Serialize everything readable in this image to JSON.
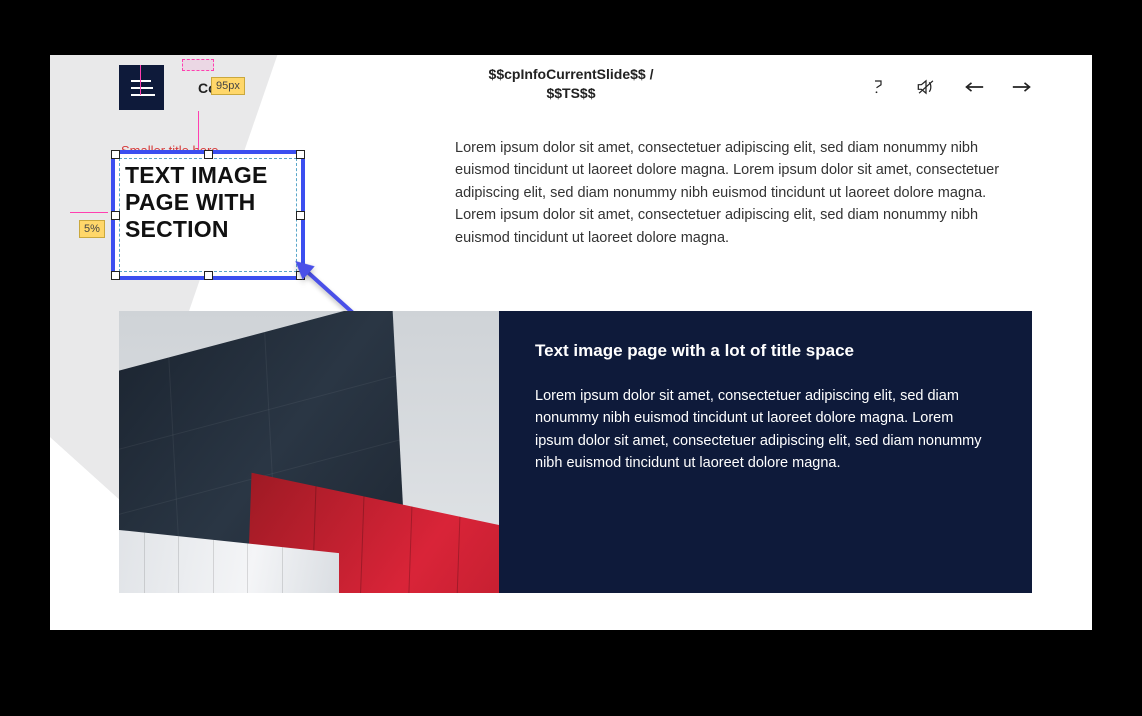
{
  "header": {
    "course_title_visible": "Co        title",
    "badge_95": "95px",
    "slide_info_line1": "$$cpInfoCurrentSlide$$ /",
    "slide_info_line2": "$$TS$$"
  },
  "small_title": "Smaller title here",
  "selected_textbox": "TEXT IMAGE PAGE WITH SECTION",
  "badge_5": "5%",
  "top_paragraph": "Lorem ipsum dolor sit amet, consectetuer adipiscing elit, sed diam nonummy nibh euismod tincidunt ut laoreet dolore magna. Lorem ipsum dolor sit amet, consectetuer adipiscing elit, sed diam nonummy nibh euismod tincidunt ut laoreet dolore magna. Lorem ipsum dolor sit amet, consectetuer adipiscing elit, sed diam nonummy nibh euismod tincidunt ut laoreet dolore magna.",
  "section": {
    "title": "Text image page with a lot of title space",
    "body": "Lorem ipsum dolor sit amet, consectetuer adipiscing elit, sed diam nonummy nibh euismod tincidunt ut laoreet dolore magna. Lorem ipsum dolor sit amet, consectetuer adipiscing elit, sed diam nonummy nibh euismod tincidunt ut laoreet dolore magna."
  },
  "icons": {
    "help": "help-icon",
    "mute": "mute-icon",
    "prev": "prev-arrow-icon",
    "next": "next-arrow-icon"
  }
}
